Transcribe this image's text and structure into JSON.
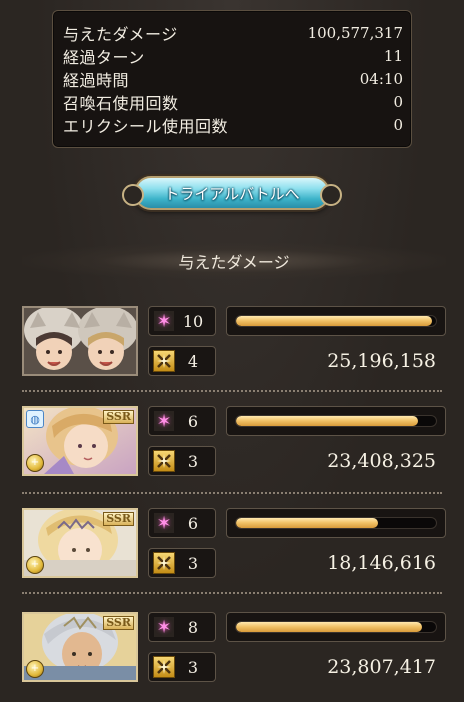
{
  "stats": {
    "rows": [
      {
        "label": "与えたダメージ",
        "value": "100,577,317"
      },
      {
        "label": "経過ターン",
        "value": "11"
      },
      {
        "label": "経過時間",
        "value": "04:10"
      },
      {
        "label": "召喚石使用回数",
        "value": "0"
      },
      {
        "label": "エリクシール使用回数",
        "value": "0"
      }
    ]
  },
  "trial_button": {
    "label": "トライアルバトルへ"
  },
  "section": {
    "title": "与えたダメージ"
  },
  "characters": [
    {
      "portrait": "two-characters-in-wolf-hoods",
      "rarity": "",
      "element_icon": "",
      "job_icon": "",
      "ability_count": "10",
      "ougi_count": "4",
      "damage": "25,196,158",
      "damage_fraction": 0.98,
      "bar_color": "#f2c46a"
    },
    {
      "portrait": "light-haired-girl-portrait",
      "rarity": "SSR",
      "element_icon": "light-element-icon",
      "job_icon": "ring-job-icon",
      "ability_count": "6",
      "ougi_count": "3",
      "damage": "23,408,325",
      "damage_fraction": 0.91,
      "bar_color": "#f2c46a"
    },
    {
      "portrait": "blonde-girl-with-tiara-portrait",
      "rarity": "SSR",
      "element_icon": "light-element-icon",
      "job_icon": "",
      "ability_count": "6",
      "ougi_count": "3",
      "damage": "18,146,616",
      "damage_fraction": 0.71,
      "bar_color": "#f2c46a"
    },
    {
      "portrait": "silver-haired-man-portrait",
      "rarity": "SSR",
      "element_icon": "light-element-icon",
      "job_icon": "",
      "ability_count": "8",
      "ougi_count": "3",
      "damage": "23,807,417",
      "damage_fraction": 0.93,
      "bar_color": "#f2c46a"
    }
  ]
}
